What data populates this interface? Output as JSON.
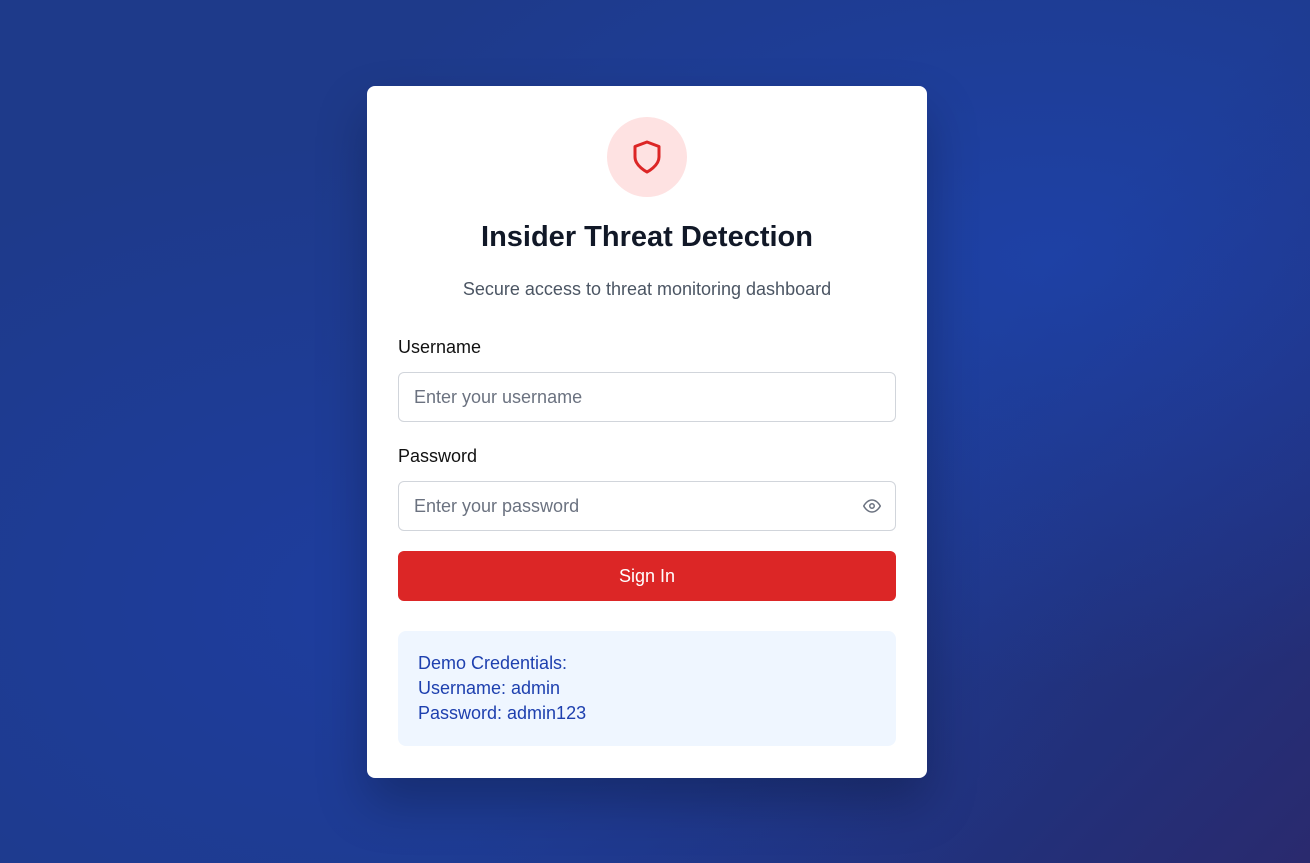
{
  "app": {
    "title": "Insider Threat Detection",
    "subtitle": "Secure access to threat monitoring dashboard",
    "logo_icon": "shield-icon"
  },
  "form": {
    "username_label": "Username",
    "username_placeholder": "Enter your username",
    "username_value": "",
    "password_label": "Password",
    "password_placeholder": "Enter your password",
    "password_value": "",
    "password_toggle_icon": "eye-icon",
    "submit_label": "Sign In"
  },
  "demo": {
    "heading": "Demo Credentials:",
    "username_line": "Username: admin",
    "password_line": "Password: admin123"
  },
  "colors": {
    "background": "#1e3a8a",
    "accent": "#dc2626",
    "logo_bg": "#fee2e2",
    "demo_bg": "#eff6ff",
    "demo_text": "#1e40af"
  }
}
